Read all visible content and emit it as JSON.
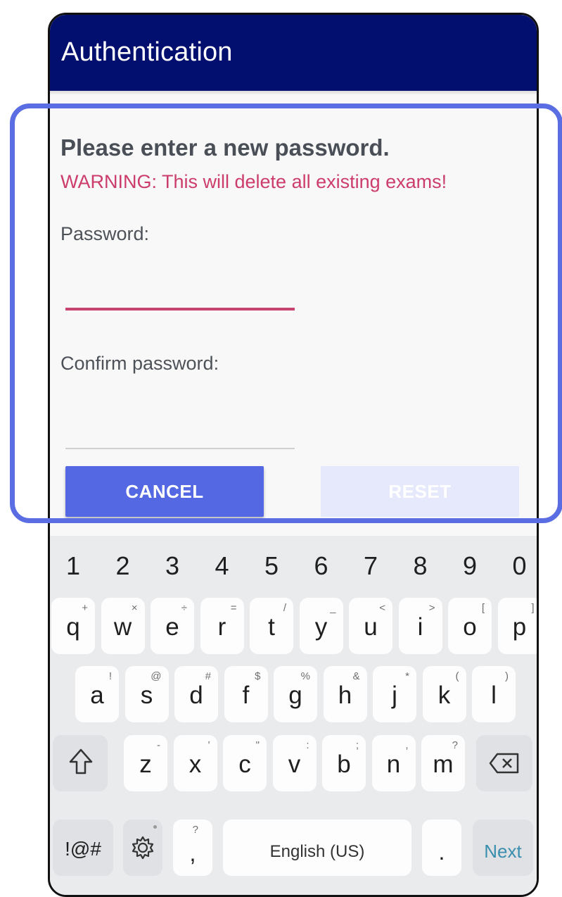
{
  "appbar": {
    "title": "Authentication"
  },
  "dialog": {
    "heading": "Please enter a new password.",
    "warning": "WARNING: This will delete all existing exams!",
    "password_label": "Password:",
    "password_value": "",
    "confirm_label": "Confirm password:",
    "confirm_value": "",
    "cancel_label": "CANCEL",
    "reset_label": "RESET"
  },
  "keyboard": {
    "numbers": [
      "1",
      "2",
      "3",
      "4",
      "5",
      "6",
      "7",
      "8",
      "9",
      "0"
    ],
    "row1": [
      {
        "k": "q",
        "h": "+"
      },
      {
        "k": "w",
        "h": "×"
      },
      {
        "k": "e",
        "h": "÷"
      },
      {
        "k": "r",
        "h": "="
      },
      {
        "k": "t",
        "h": "/"
      },
      {
        "k": "y",
        "h": "_"
      },
      {
        "k": "u",
        "h": "<"
      },
      {
        "k": "i",
        "h": ">"
      },
      {
        "k": "o",
        "h": "["
      },
      {
        "k": "p",
        "h": "]"
      }
    ],
    "row2": [
      {
        "k": "a",
        "h": "!"
      },
      {
        "k": "s",
        "h": "@"
      },
      {
        "k": "d",
        "h": "#"
      },
      {
        "k": "f",
        "h": "$"
      },
      {
        "k": "g",
        "h": "%"
      },
      {
        "k": "h",
        "h": "&"
      },
      {
        "k": "j",
        "h": "*"
      },
      {
        "k": "k",
        "h": "("
      },
      {
        "k": "l",
        "h": ")"
      }
    ],
    "row3": [
      {
        "k": "z",
        "h": "-"
      },
      {
        "k": "x",
        "h": "'"
      },
      {
        "k": "c",
        "h": "\""
      },
      {
        "k": "v",
        "h": ":"
      },
      {
        "k": "b",
        "h": ";"
      },
      {
        "k": "n",
        "h": ","
      },
      {
        "k": "m",
        "h": "?"
      }
    ],
    "shift_icon": "shift-icon",
    "backspace_icon": "backspace-icon",
    "symbols_label": "!@#",
    "settings_icon": "gear-icon",
    "comma_label": ",",
    "comma_hint": "?",
    "space_label": "English (US)",
    "period_label": ".",
    "next_label": "Next"
  },
  "colors": {
    "appbar": "#020f6e",
    "primary_button": "#5468e3",
    "disabled_button": "#e6e9fb",
    "warning": "#cc3d6b",
    "highlight_border": "#5a6de3",
    "next_key": "#3a8eae"
  }
}
